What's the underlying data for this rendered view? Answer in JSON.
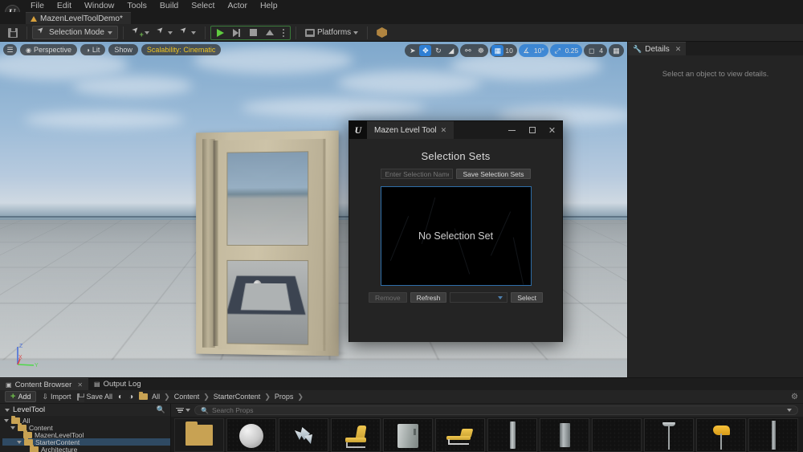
{
  "menu": {
    "items": [
      "File",
      "Edit",
      "Window",
      "Tools",
      "Build",
      "Select",
      "Actor",
      "Help"
    ],
    "logo_glyph": "U"
  },
  "level_tab": {
    "label": "MazenLevelToolDemo*"
  },
  "toolbar": {
    "save_tooltip": "Save",
    "selection_mode_label": "Selection Mode",
    "platforms_label": "Platforms",
    "icons": [
      "save-icon",
      "selection-mode-icon",
      "add-actor-icon",
      "blueprints-icon",
      "cinematics-icon",
      "play-icon",
      "step-icon",
      "stop-icon",
      "eject-icon",
      "play-options-icon",
      "platforms-icon",
      "settings-cube-icon"
    ]
  },
  "viewport": {
    "menu_icon": "viewport-menu-icon",
    "perspective_label": "Perspective",
    "lit_label": "Lit",
    "show_label": "Show",
    "scalability_label": "Scalability: Cinematic",
    "transform_tools": [
      "select-icon",
      "translate-icon",
      "rotate-icon",
      "scale-icon"
    ],
    "coordinate_icons": [
      "world-coords-icon",
      "surface-snap-icon"
    ],
    "grid_snap_value": "10",
    "angle_snap_value": "10°",
    "scale_snap_value": "0.25",
    "camera_speed_value": "4",
    "layout_icon": "viewport-layout-icon",
    "axis_labels": {
      "x": "X",
      "y": "Y",
      "z": "Z"
    }
  },
  "details_panel": {
    "tab_label": "Details",
    "tab_icon": "wrench-icon",
    "close_icon": "close-icon",
    "empty_message": "Select an object to view details."
  },
  "mazen_tool": {
    "window_title": "Mazen Level Tool",
    "app_icon_glyph": "U",
    "tab_close_icon": "close-icon",
    "minimize_icon": "minimize-icon",
    "maximize_icon": "maximize-icon",
    "close_icon": "close-icon",
    "section_title": "Selection Sets",
    "name_input_placeholder": "Enter Selection Name...",
    "name_input_value": "",
    "save_button_label": "Save Selection Sets",
    "list_empty_message": "No Selection Set",
    "list_border_color": "#2e6ea8",
    "remove_button_label": "Remove",
    "remove_button_disabled": true,
    "refresh_button_label": "Refresh",
    "dropdown_value": "",
    "select_button_label": "Select"
  },
  "content_browser": {
    "tabs": [
      {
        "label": "Content Browser",
        "icon": "content-browser-icon",
        "active": true
      },
      {
        "label": "Output Log",
        "icon": "output-log-icon",
        "active": false
      }
    ],
    "add_button_label": "Add",
    "import_button_label": "Import",
    "save_all_button_label": "Save All",
    "nav_back_icon": "nav-back-icon",
    "nav_forward_icon": "nav-forward-icon",
    "breadcrumb": [
      "All",
      "Content",
      "StarterContent",
      "Props"
    ],
    "settings_icon": "gear-icon",
    "tree_title": "LevelTool",
    "tree_search_icon": "search-icon",
    "tree": [
      {
        "label": "All",
        "depth": 0,
        "expanded": true,
        "selected": false
      },
      {
        "label": "Content",
        "depth": 1,
        "expanded": true,
        "selected": false
      },
      {
        "label": "MazenLevelTool",
        "depth": 2,
        "expanded": false,
        "selected": false
      },
      {
        "label": "StarterContent",
        "depth": 2,
        "expanded": true,
        "selected": true
      },
      {
        "label": "Architecture",
        "depth": 3,
        "expanded": false,
        "selected": false
      }
    ],
    "filter_icon": "filter-icon",
    "search_placeholder": "Search Props",
    "search_value": "",
    "search_icon": "search-icon",
    "assets": [
      {
        "name": "folder-asset",
        "kind": "folder"
      },
      {
        "name": "sphere-asset",
        "kind": "ball"
      },
      {
        "name": "shards-asset",
        "kind": "shard"
      },
      {
        "name": "chair-asset",
        "kind": "chair"
      },
      {
        "name": "appliance-asset",
        "kind": "fridge"
      },
      {
        "name": "bench-asset",
        "kind": "bench"
      },
      {
        "name": "pipe-asset",
        "kind": "pipe"
      },
      {
        "name": "pillar-asset",
        "kind": "pipe2"
      },
      {
        "name": "lamp-asset",
        "kind": "lamp"
      },
      {
        "name": "table-lamp-asset",
        "kind": "lamp2"
      },
      {
        "name": "column-asset",
        "kind": "pillar"
      }
    ]
  }
}
